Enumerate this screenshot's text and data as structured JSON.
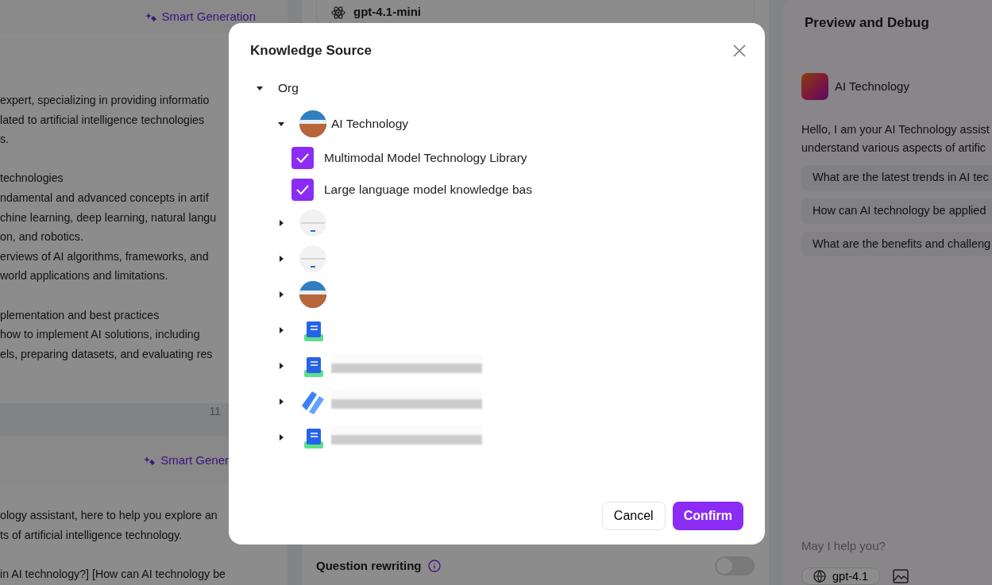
{
  "left_panel": {
    "sections": [
      {
        "action": "Smart Generation",
        "paragraphs": [
          [
            "expert, specializing in providing informatio",
            "lated to artificial intelligence technologies",
            "s."
          ],
          [
            "technologies",
            "ndamental and advanced concepts in artif",
            "chine learning, deep learning, natural langu",
            "on, and robotics.",
            "erviews of AI algorithms, frameworks, and",
            "world applications and limitations."
          ],
          [
            "plementation and best practices",
            "how to implement AI solutions, including",
            "els, preparing datasets, and evaluating res"
          ]
        ],
        "counter": "11"
      },
      {
        "action": "Smart Gener",
        "paragraphs": [
          [
            "ology assistant, here to help you explore an",
            "ts of artificial intelligence technology."
          ],
          [
            "in AI technology?] [How can AI technology be"
          ]
        ]
      }
    ]
  },
  "middle_panel": {
    "model": "gpt-4.1-mini",
    "settings": [
      {
        "label": "Question rewriting",
        "on": false
      }
    ]
  },
  "preview": {
    "title": "Preview and Debug",
    "assistant_name": "AI Technology",
    "greeting_lines": [
      "Hello, I am your AI Technology assist",
      "understand various aspects of artific"
    ],
    "suggestions": [
      "What are the latest trends in AI tec",
      "How can AI technology be applied",
      "What are the benefits and challeng"
    ],
    "input": {
      "placeholder": "May I help you?"
    },
    "model_button": "gpt-4.1"
  },
  "dialog": {
    "title": "Knowledge Source",
    "tree": [
      {
        "label": "Org",
        "expanded": true,
        "children": [
          {
            "kind": "photo",
            "label": "AI Technology",
            "expanded": true,
            "children": [
              {
                "label": "Multimodal Model Technology Library",
                "checked": true
              },
              {
                "label": "Large language model knowledge bas",
                "checked": true
              }
            ]
          },
          {
            "kind": "logo",
            "expanded": false
          },
          {
            "kind": "logo",
            "expanded": false
          },
          {
            "kind": "photo",
            "expanded": false
          },
          {
            "kind": "book",
            "expanded": false
          },
          {
            "kind": "book",
            "expanded": false,
            "redacted": true
          },
          {
            "kind": "stripes",
            "expanded": false,
            "redacted": true
          },
          {
            "kind": "book",
            "expanded": false,
            "redacted": true
          }
        ]
      }
    ],
    "buttons": [
      {
        "label": "Cancel",
        "kind": "secondary"
      },
      {
        "label": "Confirm",
        "kind": "primary"
      }
    ]
  }
}
